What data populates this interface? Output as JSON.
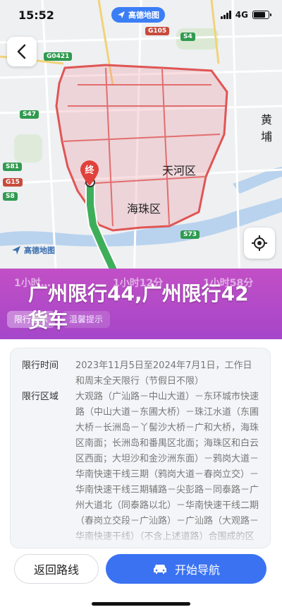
{
  "status": {
    "time": "15:52",
    "network": "4G"
  },
  "brand": {
    "app_name": "高德地图"
  },
  "map": {
    "districts": [
      "天河区",
      "海珠区",
      "黄埔"
    ],
    "road_shields": [
      "G105",
      "S4",
      "G0421",
      "S47",
      "S81",
      "S73",
      "G15",
      "S8"
    ],
    "end_marker": "终",
    "logo": "高德地图"
  },
  "route_tabs": [
    "1小时…",
    "1小时12分",
    "1小时58分"
  ],
  "banner": {
    "title": "广州限行44,广州限行42货车"
  },
  "chips": [
    "限行提示",
    "温馨提示"
  ],
  "restriction": {
    "time_label": "限行时间",
    "time_value": "2023年11月5日至2024年7月1日，工作日和周末全天限行（节假日不限）",
    "area_label": "限行区域",
    "area_value": "大观路（广汕路－中山大道）－东环城市快速路（中山大道－东圃大桥）－珠江水道（东圃大桥－长洲岛－丫髻沙大桥－广和大桥，海珠区南面；长洲岛和番禺区北面；海珠区和白云区西面；大坦沙和金沙洲东面）－鸦岗大道－华南快速干线三期（鸦岗大道－春岗立交）－华南快速干线三期辅路－尖彭路－同泰路－广州大道北（同泰路以北）－华南快速干线二期（春岗立交段－广汕路）－广汕路（大观路－华南快速干线）（不含上述道路）合围成的区域（含洛溪大桥、鹤洞大桥、洲头咀隧"
  },
  "actions": {
    "back_route": "返回路线",
    "start_nav": "开始导航"
  },
  "colors": {
    "accent": "#3a72f2",
    "banner": "#b04ac8",
    "zone_border": "#e05555",
    "route": "#3fae5a"
  }
}
